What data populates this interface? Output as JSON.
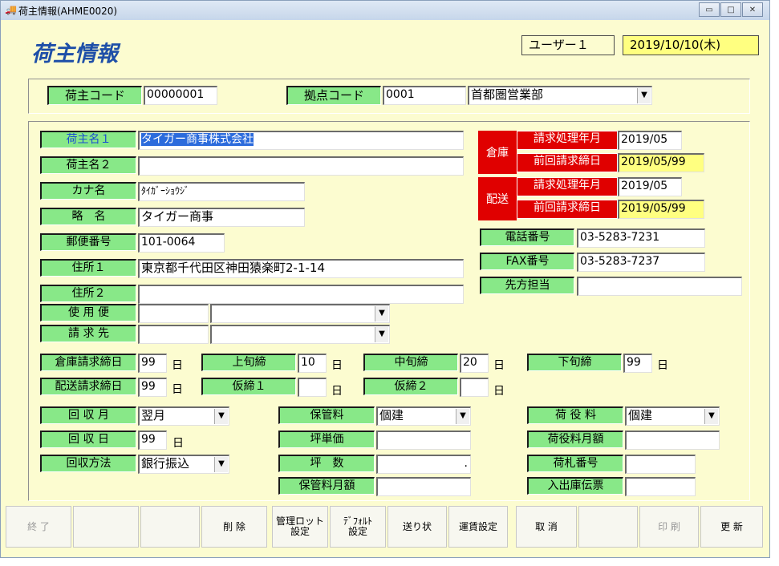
{
  "window": {
    "title": "荷主情報(AHME0020)",
    "icon": "truck-app-icon",
    "min": "▭",
    "max": "□",
    "close": "✕"
  },
  "page_title": "荷主情報",
  "header": {
    "user": "ユーザー１",
    "date": "2019/10/10(木)"
  },
  "codes": {
    "shipper_code_label": "荷主コード",
    "shipper_code": "00000001",
    "base_code_label": "拠点コード",
    "base_code": "0001",
    "base_name": "首都圏営業部"
  },
  "info": {
    "name1_label": "荷主名１",
    "name1": "タイガー商事株式会社",
    "name2_label": "荷主名２",
    "name2": "",
    "kana_label": "カナ名",
    "kana": "ﾀｲｶﾞｰｼｮｳｼﾞ",
    "short_label": "略　名",
    "short": "タイガー商事",
    "zip_label": "郵便番号",
    "zip": "101-0064",
    "addr1_label": "住所１",
    "addr1": "東京都千代田区神田猿楽町2-1-14",
    "addr2_label": "住所２",
    "addr2": ""
  },
  "billing": {
    "warehouse_label": "倉庫",
    "delivery_label": "配送",
    "month_label": "請求処理年月",
    "prev_label": "前回請求締日",
    "wh_month": "2019/05",
    "wh_prev": "2019/05/99",
    "dl_month": "2019/05",
    "dl_prev": "2019/05/99"
  },
  "contact": {
    "tel_label": "電話番号",
    "tel": "03-5283-7231",
    "fax_label": "FAX番号",
    "fax": "03-5283-7237",
    "person_label": "先方担当",
    "person": ""
  },
  "use": {
    "label": "使 用 便",
    "code": "",
    "name": ""
  },
  "bill_to": {
    "label": "請 求 先",
    "code": "",
    "name": ""
  },
  "closing": {
    "day_unit": "日",
    "wh_close_label": "倉庫請求締日",
    "wh_close": "99",
    "dl_close_label": "配送請求締日",
    "dl_close": "99",
    "early_label": "上旬締",
    "early": "10",
    "mid_label": "中旬締",
    "mid": "20",
    "late_label": "下旬締",
    "late": "99",
    "temp1_label": "仮締１",
    "temp1": "",
    "temp2_label": "仮締２",
    "temp2": ""
  },
  "collection": {
    "month_label": "回 収 月",
    "month": "翌月",
    "day_label": "回 収 日",
    "day": "99",
    "method_label": "回収方法",
    "method": "銀行振込"
  },
  "storage": {
    "fee_label": "保管料",
    "fee": "個建",
    "tsubo_price_label": "坪単価",
    "tsubo_price": "",
    "tsubo_label": "坪　数",
    "tsubo": ".",
    "monthly_label": "保管料月額",
    "monthly": ""
  },
  "handling": {
    "fee_label": "荷 役 料",
    "fee": "個建",
    "monthly_label": "荷役料月額",
    "monthly": "",
    "tag_label": "荷札番号",
    "tag": "",
    "slip_label": "入出庫伝票",
    "slip": ""
  },
  "buttons": {
    "end": "終 了",
    "blank1": "",
    "blank2": "",
    "delete": "削 除",
    "lot": "管理ロット\n設定",
    "default": "ﾃﾞﾌｫﾙﾄ\n設定",
    "invoice": "送り状",
    "fare": "運賃設定",
    "cancel": "取 消",
    "blank3": "",
    "print": "印 刷",
    "update": "更 新"
  }
}
